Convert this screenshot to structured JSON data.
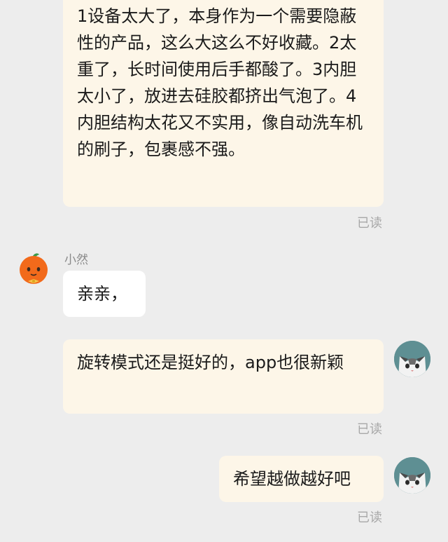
{
  "messages": [
    {
      "text": "1设备太大了，本身作为一个需要隐蔽性的产品，这么大这么不好收藏。2太重了，长时间使用后手都酸了。3内胆太小了，放进去硅胶都挤出气泡了。4内胆结构太花又不实用，像自动洗车机的刷子，包裹感不强。",
      "status": "已读"
    },
    {
      "sender": "小然",
      "text": "亲亲，"
    },
    {
      "text": "旋转模式还是挺好的，app也很新颖",
      "status": "已读"
    },
    {
      "text": "希望越做越好吧",
      "status": "已读"
    }
  ],
  "colors": {
    "background": "#ededed",
    "outgoing_bubble": "#fdf6e8",
    "incoming_bubble": "#ffffff",
    "read_text": "#a8a8a8"
  }
}
